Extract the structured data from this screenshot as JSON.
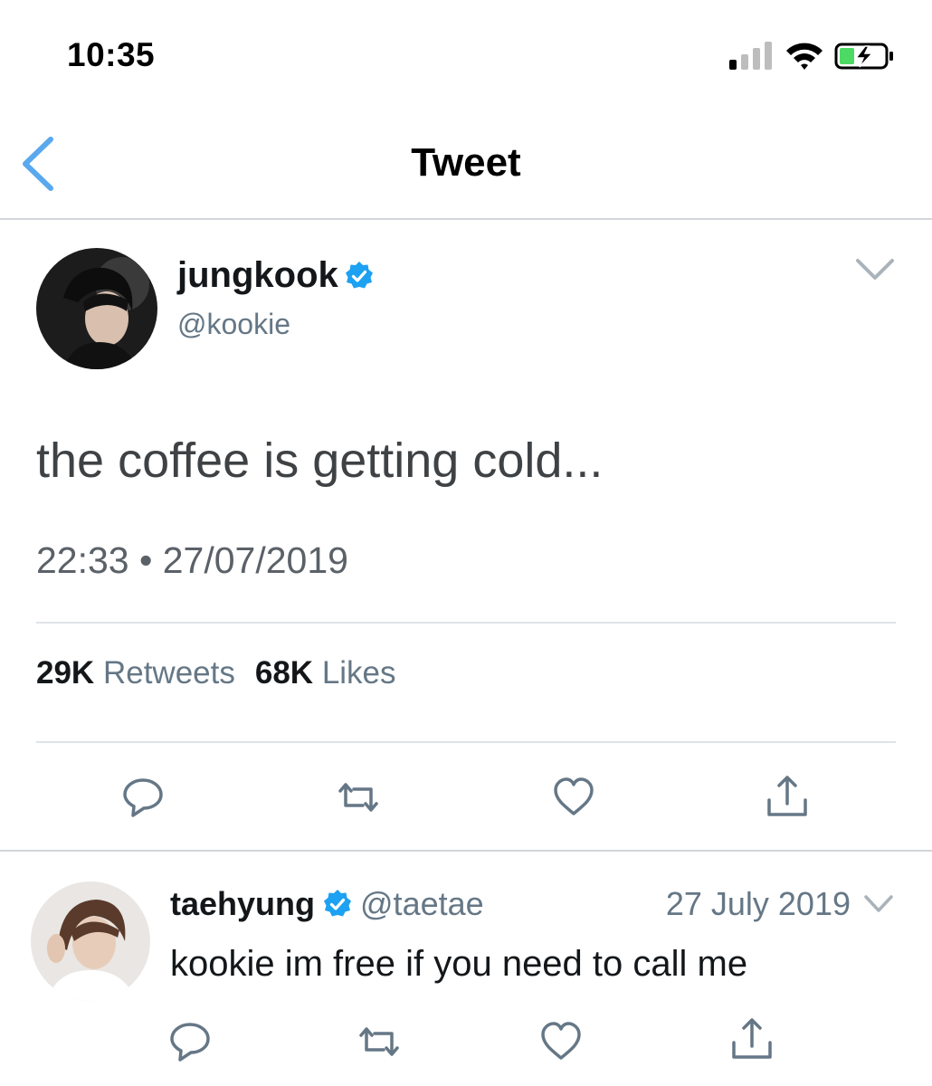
{
  "status_bar": {
    "time": "10:35",
    "signal_icon": "cellular-signal-icon",
    "wifi_icon": "wifi-icon",
    "battery_icon": "battery-charging-icon"
  },
  "nav": {
    "title": "Tweet",
    "back_icon": "chevron-left-icon"
  },
  "tweet": {
    "author_name": "jungkook",
    "verified": true,
    "handle": "@kookie",
    "text": "the coffee is getting cold...",
    "timestamp": "22:33 • 27/07/2019",
    "retweets_count": "29K",
    "retweets_label": "Retweets",
    "likes_count": "68K",
    "likes_label": "Likes"
  },
  "reply": {
    "author_name": "taehyung",
    "verified": true,
    "handle": "@taetae",
    "date": "27 July 2019",
    "text": "kookie im free if you need to call me"
  },
  "colors": {
    "accent": "#1da1f2",
    "back_arrow": "#5aa8ee",
    "icon_gray": "#657786",
    "divider": "#d2d6db"
  }
}
